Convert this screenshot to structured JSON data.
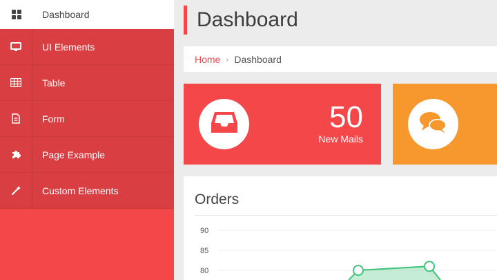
{
  "sidebar": {
    "items": [
      {
        "label": "Dashboard",
        "icon": "dashboard-grid-icon"
      },
      {
        "label": "UI Elements",
        "icon": "desktop-icon"
      },
      {
        "label": "Table",
        "icon": "table-icon"
      },
      {
        "label": "Form",
        "icon": "document-icon"
      },
      {
        "label": "Page Example",
        "icon": "puzzle-icon"
      },
      {
        "label": "Custom Elements",
        "icon": "magic-wand-icon"
      }
    ]
  },
  "header": {
    "title": "Dashboard"
  },
  "breadcrumb": {
    "home": "Home",
    "separator": "›",
    "current": "Dashboard"
  },
  "stats": [
    {
      "value": "50",
      "label": "New Mails",
      "icon": "inbox-icon",
      "color": "#f4474a"
    },
    {
      "value": "",
      "label": "",
      "icon": "chat-bubbles-icon",
      "color": "#f7982f"
    }
  ],
  "orders": {
    "title": "Orders"
  },
  "chart_data": {
    "type": "area",
    "yticks": [
      90,
      85,
      80
    ],
    "points": [
      {
        "y": 80
      },
      {
        "y": 81
      }
    ],
    "color": "#7fd6a5"
  },
  "colors": {
    "accent": "#f4474a",
    "orange": "#f7982f"
  }
}
